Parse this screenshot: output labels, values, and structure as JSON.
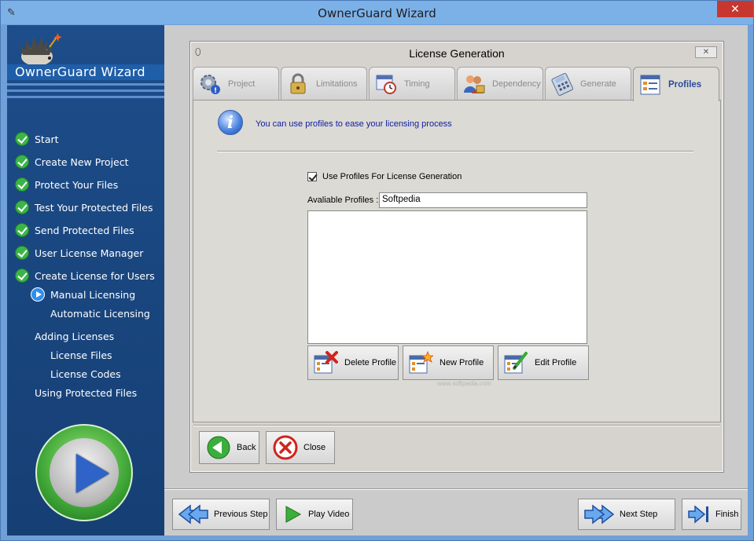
{
  "window": {
    "title": "OwnerGuard Wizard"
  },
  "sidebar": {
    "brand": "OwnerGuard Wizard",
    "steps": [
      {
        "label": "Start",
        "state": "done"
      },
      {
        "label": "Create New Project",
        "state": "done"
      },
      {
        "label": "Protect Your Files",
        "state": "done"
      },
      {
        "label": "Test Your Protected Files",
        "state": "done"
      },
      {
        "label": "Send Protected Files",
        "state": "done"
      },
      {
        "label": "User License Manager",
        "state": "done"
      },
      {
        "label": "Create License for Users",
        "state": "done"
      },
      {
        "label": "Manual Licensing",
        "state": "current"
      },
      {
        "label": "Automatic Licensing",
        "state": "none"
      },
      {
        "label": "Adding Licenses",
        "state": "none"
      },
      {
        "label": "License Files",
        "state": "none"
      },
      {
        "label": "License Codes",
        "state": "none"
      },
      {
        "label": "Using Protected Files",
        "state": "none"
      }
    ]
  },
  "dialog": {
    "title": "License Generation",
    "tabs": [
      {
        "label": "Project",
        "icon": "gear-alert-icon"
      },
      {
        "label": "Limitations",
        "icon": "padlock-icon"
      },
      {
        "label": "Timing",
        "icon": "calendar-clock-icon"
      },
      {
        "label": "Dependency",
        "icon": "users-lock-icon"
      },
      {
        "label": "Generate",
        "icon": "calculator-icon"
      },
      {
        "label": "Profiles",
        "icon": "form-list-icon",
        "active": true
      }
    ],
    "info_text": "You can use profiles to ease your licensing process",
    "use_profiles_label": "Use Profiles For License Generation",
    "use_profiles_checked": true,
    "available_profiles_label": "Avaliable Profiles :",
    "available_profiles_value": "Softpedia",
    "buttons": {
      "delete_profile": "Delete Profile",
      "new_profile": "New Profile",
      "edit_profile": "Edit Profile",
      "back": "Back",
      "close": "Close"
    },
    "watermark": "www.softpedia.com"
  },
  "footer": {
    "previous_step": "Previous Step",
    "play_video": "Play Video",
    "next_step": "Next Step",
    "finish": "Finish"
  },
  "colors": {
    "sidebar_bg": "#18457d",
    "titlebar_bg": "#7cb1e8",
    "close_red": "#c7372f",
    "check_green": "#3bb44a",
    "active_tab_text": "#2a4b9a",
    "info_text": "#1020a0"
  }
}
